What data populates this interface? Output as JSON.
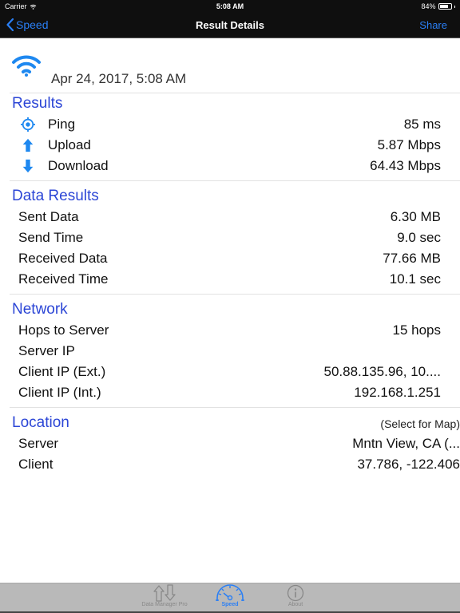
{
  "status_bar": {
    "carrier": "Carrier",
    "time": "5:08 AM",
    "battery": "84%",
    "battery_level": 0.84
  },
  "nav": {
    "back_label": "Speed",
    "title": "Result Details",
    "share_label": "Share"
  },
  "header": {
    "date": "Apr 24, 2017, 5:08 AM"
  },
  "results": {
    "title": "Results",
    "rows": [
      {
        "label": "Ping",
        "value": "85 ms",
        "icon": "target-icon"
      },
      {
        "label": "Upload",
        "value": "5.87 Mbps",
        "icon": "upload-arrow-icon"
      },
      {
        "label": "Download",
        "value": "64.43 Mbps",
        "icon": "download-arrow-icon"
      }
    ]
  },
  "data_results": {
    "title": "Data Results",
    "rows": [
      {
        "label": "Sent Data",
        "value": "6.30 MB"
      },
      {
        "label": "Send Time",
        "value": "9.0 sec"
      },
      {
        "label": "Received Data",
        "value": "77.66 MB"
      },
      {
        "label": "Received Time",
        "value": "10.1 sec"
      }
    ]
  },
  "network": {
    "title": "Network",
    "rows": [
      {
        "label": "Hops to Server",
        "value": "15 hops"
      },
      {
        "label": "Server IP",
        "value": ""
      },
      {
        "label": "Client IP (Ext.)",
        "value": "50.88.135.96, 10...."
      },
      {
        "label": "Client IP (Int.)",
        "value": "192.168.1.251"
      }
    ]
  },
  "location": {
    "title": "Location",
    "hint": "(Select for Map)",
    "rows": [
      {
        "label": "Server",
        "value": "Mntn View, CA (..."
      },
      {
        "label": "Client",
        "value": "37.786, -122.406"
      }
    ]
  },
  "tab_bar": {
    "tabs": [
      {
        "label": "Data Manager Pro",
        "icon": "transfer-arrows-icon",
        "active": false
      },
      {
        "label": "Speed",
        "icon": "speedometer-icon",
        "active": true
      },
      {
        "label": "About",
        "icon": "info-icon",
        "active": false
      }
    ]
  },
  "colors": {
    "accent": "#2a7ff5",
    "section_title": "#2c46d6",
    "bars": "#0f0f0f",
    "tab_bar": "#b9b9b9"
  }
}
